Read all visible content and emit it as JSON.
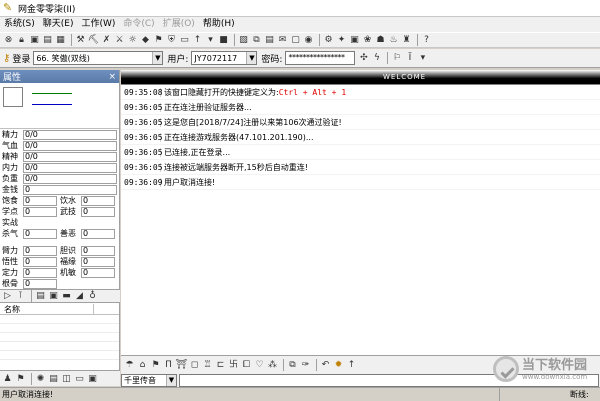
{
  "window": {
    "title": "网金零零柒(II)"
  },
  "menu": [
    {
      "label": "系统(S)",
      "disabled": false
    },
    {
      "label": "聊天(E)",
      "disabled": false
    },
    {
      "label": "工作(W)",
      "disabled": false
    },
    {
      "label": "命令(C)",
      "disabled": true
    },
    {
      "label": "扩展(O)",
      "disabled": true
    },
    {
      "label": "帮助(H)",
      "disabled": false
    }
  ],
  "toolbar2": {
    "login_label": "登录",
    "server_value": "66. 笑傲(双线)",
    "user_label": "用户:",
    "user_value": "JY7072117",
    "password_label": "密码:",
    "password_value": "****************"
  },
  "left_panel": {
    "header": "属性",
    "close": "×",
    "stats": [
      {
        "label": "精力",
        "value": "0/0"
      },
      {
        "label": "气血",
        "value": "0/0"
      },
      {
        "label": "精神",
        "value": "0/0"
      },
      {
        "label": "内力",
        "value": "0/0"
      },
      {
        "label": "负重",
        "value": "0/0"
      },
      {
        "label": "金钱",
        "value": "0"
      }
    ],
    "pairs1": [
      {
        "label": "饱食",
        "value": "0",
        "label2": "饮水",
        "value2": "0"
      },
      {
        "label": "学点",
        "value": "0",
        "label2": "武技",
        "value2": "0"
      },
      {
        "label": "实战",
        "value": "",
        "label2": "",
        "value2": ""
      },
      {
        "label": "杀气",
        "value": "0",
        "label2": "善恶",
        "value2": "0"
      }
    ],
    "pairs2": [
      {
        "label": "臂力",
        "value": "0",
        "label2": "胆识",
        "value2": "0"
      },
      {
        "label": "悟性",
        "value": "0",
        "label2": "福缘",
        "value2": "0"
      },
      {
        "label": "定力",
        "value": "0",
        "label2": "机敏",
        "value2": "0"
      },
      {
        "label": "根骨",
        "value": "0",
        "label2": "",
        "value2": ""
      }
    ],
    "name_header": "名称"
  },
  "banner": {
    "text": "WELCOME"
  },
  "log": [
    {
      "time": "09:35:08",
      "msg": "该窗口隐藏打开的快捷键定义为:",
      "hl": "Ctrl + Alt + 1"
    },
    {
      "time": "09:36:05",
      "msg": "正在连注册验证服务器...",
      "hl": ""
    },
    {
      "time": "09:36:05",
      "msg": "这是您自[2018/7/24]注册以来第106次通过验证!",
      "hl": ""
    },
    {
      "time": "09:36:05",
      "msg": "正在连接游戏服务器(47.101.201.190)...",
      "hl": ""
    },
    {
      "time": "09:36:05",
      "msg": "已连接,正在登录...",
      "hl": ""
    },
    {
      "time": "09:36:05",
      "msg": "连接被远端服务器断开,15秒后自动重连!",
      "hl": ""
    },
    {
      "time": "09:36:09",
      "msg": "用户取消连接!",
      "hl": ""
    }
  ],
  "chat": {
    "channel": "千里传音"
  },
  "status": {
    "main": "用户取消连接!",
    "right": "断线:"
  },
  "watermark": {
    "cn": "当下软件园",
    "url": "www.downxia.com"
  }
}
